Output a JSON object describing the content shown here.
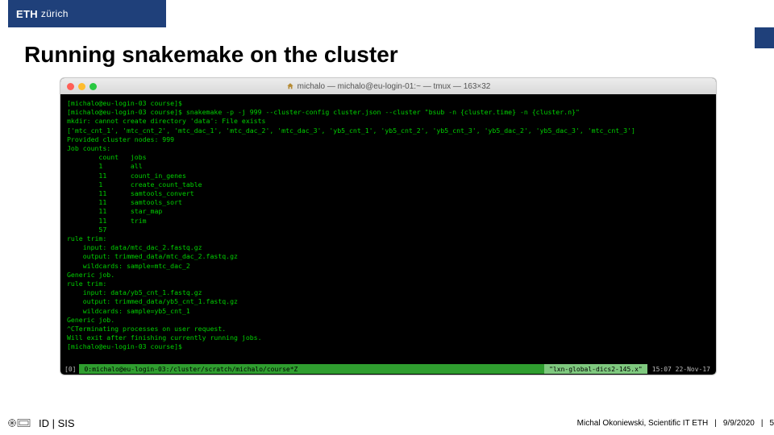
{
  "brand": {
    "eth": "ETH",
    "zurich": "zürich"
  },
  "title": "Running snakemake on the cluster",
  "window": {
    "title": "michalo — michalo@eu-login-01:~ — tmux — 163×32"
  },
  "terminal": {
    "lines": [
      "[michalo@eu-login-03 course]$",
      "[michalo@eu-login-03 course]$ snakemake -p -j 999 --cluster-config cluster.json --cluster \"bsub -n {cluster.time} -n {cluster.n}\"",
      "",
      "mkdir: cannot create directory 'data': File exists",
      "['mtc_cnt_1', 'mtc_cnt_2', 'mtc_dac_1', 'mtc_dac_2', 'mtc_dac_3', 'yb5_cnt_1', 'yb5_cnt_2', 'yb5_cnt_3', 'yb5_dac_2', 'yb5_dac_3', 'mtc_cnt_3']",
      "Provided cluster nodes: 999",
      "Job counts:",
      "        count   jobs",
      "        1       all",
      "        11      count_in_genes",
      "        1       create_count_table",
      "        11      samtools_convert",
      "        11      samtools_sort",
      "        11      star_map",
      "        11      trim",
      "        57",
      "rule trim:",
      "    input: data/mtc_dac_2.fastq.gz",
      "    output: trimmed_data/mtc_dac_2.fastq.gz",
      "    wildcards: sample=mtc_dac_2",
      "",
      "Generic job.",
      "rule trim:",
      "    input: data/yb5_cnt_1.fastq.gz",
      "    output: trimmed_data/yb5_cnt_1.fastq.gz",
      "    wildcards: sample=yb5_cnt_1",
      "",
      "Generic job.",
      "^CTerminating processes on user request.",
      "Will exit after finishing currently running jobs.",
      "[michalo@eu-login-03 course]$"
    ]
  },
  "status": {
    "box0": "[0]",
    "mid": "0:michalo@eu-login-03:/cluster/scratch/michalo/course*Z",
    "host": "\"lxn-global-dics2-145.x\"",
    "time": "15:07 22-Nov-17"
  },
  "footer": {
    "left": "ID | SIS",
    "author": "Michal Okoniewski, Scientific IT ETH",
    "date": "9/9/2020",
    "page": "5"
  }
}
